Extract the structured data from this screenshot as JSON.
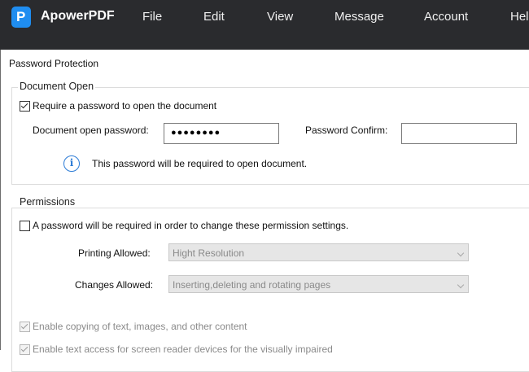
{
  "app": {
    "name": "ApowerPDF",
    "logo_letter": "P"
  },
  "menu": {
    "items": [
      "File",
      "Edit",
      "View",
      "Message",
      "Account",
      "Help"
    ]
  },
  "dialog": {
    "title": "Password Protection",
    "document_open": {
      "group_label": "Document Open",
      "require_checkbox": {
        "label": "Require a password to open the document",
        "checked": true
      },
      "open_password": {
        "label": "Document open password:",
        "value": "●●●●●●●●"
      },
      "confirm_password": {
        "label": "Password Confirm:",
        "value": ""
      },
      "info_text": "This password will be required to open document."
    },
    "permissions": {
      "group_label": "Permissions",
      "require_checkbox": {
        "label": "A password will be required in order to change these permission settings.",
        "checked": false
      },
      "printing": {
        "label": "Printing Allowed:",
        "value": "Hight Resolution"
      },
      "changes": {
        "label": "Changes Allowed:",
        "value": "Inserting,deleting and rotating pages"
      },
      "copy_checkbox": {
        "label": "Enable copying of text, images, and other content",
        "checked": true
      },
      "screen_reader_checkbox": {
        "label": "Enable text access for screen reader devices for the visually impaired",
        "checked": true
      }
    }
  },
  "colors": {
    "topbar": "#2a2b2e",
    "logo": "#1f8df0",
    "info_icon": "#2b7bd6"
  },
  "icons": {
    "info": "info-icon",
    "logo": "apowerpdf-logo-icon",
    "dropdown": "chevron-down-icon"
  }
}
